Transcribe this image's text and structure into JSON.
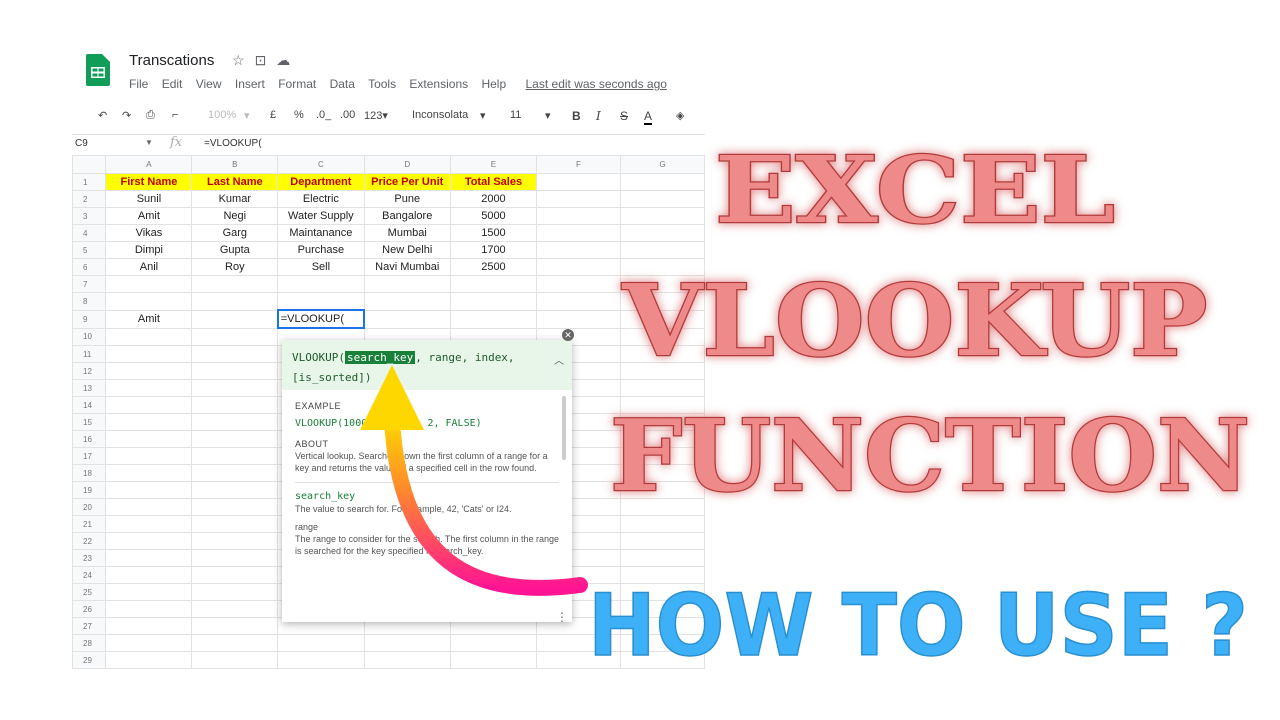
{
  "doc": {
    "title": "Transcations",
    "title_icons": [
      "star-icon",
      "folder-icon",
      "cloud-icon"
    ],
    "menu": [
      "File",
      "Edit",
      "View",
      "Insert",
      "Format",
      "Data",
      "Tools",
      "Extensions",
      "Help"
    ],
    "last_edit": "Last edit was seconds ago"
  },
  "toolbar": {
    "zoom": "100%",
    "currency": "£",
    "percent": "%",
    "dec_less": ".0_",
    "dec_more": ".00",
    "format_123": "123▾",
    "font": "Inconsolata",
    "size": "11",
    "bold": "B",
    "italic": "I",
    "strike": "S",
    "text_color": "A"
  },
  "formula_bar": {
    "cell": "C9",
    "fx": "fx",
    "text": "=VLOOKUP("
  },
  "columns": [
    "A",
    "B",
    "C",
    "D",
    "E",
    "F",
    "G"
  ],
  "header_row": [
    "First Name",
    "Last Name",
    "Department",
    "Price Per Unit",
    "Total Sales"
  ],
  "rows": [
    [
      "Sunil",
      "Kumar",
      "Electric",
      "Pune",
      "2000"
    ],
    [
      "Amit",
      "Negi",
      "Water Supply",
      "Bangalore",
      "5000"
    ],
    [
      "Vikas",
      "Garg",
      "Maintanance",
      "Mumbai",
      "1500"
    ],
    [
      "Dimpi",
      "Gupta",
      "Purchase",
      "New Delhi",
      "1700"
    ],
    [
      "Anil",
      "Roy",
      "Sell",
      "Navi Mumbai",
      "2500"
    ]
  ],
  "row9": {
    "a": "Amit",
    "c": "=VLOOKUP("
  },
  "row_numbers": [
    "1",
    "2",
    "3",
    "4",
    "5",
    "6",
    "7",
    "8",
    "9",
    "10",
    "11",
    "12",
    "13",
    "14",
    "15",
    "16",
    "17",
    "18",
    "19",
    "20",
    "21",
    "22",
    "23",
    "24",
    "25",
    "26",
    "27",
    "28",
    "29"
  ],
  "tooltip": {
    "sig_pre": "VLOOKUP(",
    "sig_hl": "search_key",
    "sig_post": ", range, index,",
    "sig_line2": "[is_sorted])",
    "example_label": "EXAMPLE",
    "example": "VLOOKUP(1000, A2:B26, 2, FALSE)",
    "about_label": "ABOUT",
    "about": "Vertical lookup. Searches down the first column of a range for a key and returns the value of a specified cell in the row found.",
    "arg1_name": "search_key",
    "arg1_desc": "The value to search for. For example, 42, 'Cats' or I24.",
    "arg2_name": "range",
    "arg2_desc": "The range to consider for the search. The first column in the range is searched for the key specified in search_key."
  },
  "overlay": {
    "line1": "EXCEL",
    "line2": "VLOOKUP",
    "line3": "FUNCTION",
    "how": "HOW TO USE ?"
  },
  "colors": {
    "header_fill": "#ffff00",
    "header_text": "#c00000",
    "title_fill": "#ef8a8a",
    "how_fill": "#3db0f7",
    "arrow_start": "#ff1493",
    "arrow_end": "#ffd700"
  }
}
